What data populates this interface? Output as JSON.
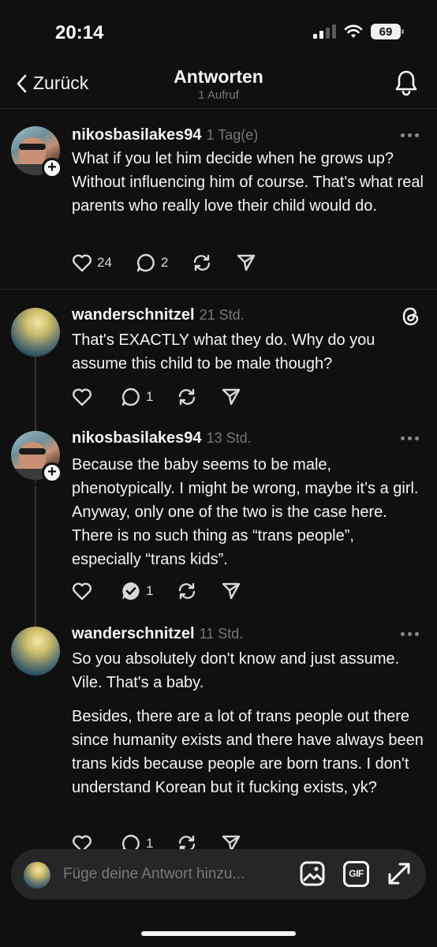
{
  "status_bar": {
    "time": "20:14",
    "battery": "69"
  },
  "nav": {
    "back_label": "Zurück",
    "title": "Antworten",
    "subtitle": "1 Aufruf"
  },
  "posts": [
    {
      "username": "nikosbasilakes94",
      "time": "1 Tag(e)",
      "paragraphs": [
        "What if you let him decide when he grows up? Without influencing him of course. That's what real parents who really love their child would do."
      ],
      "likes": "24",
      "replies": "2"
    },
    {
      "username": "wanderschnitzel",
      "time": "21 Std.",
      "paragraphs": [
        "That's EXACTLY what they do. Why do you assume this child to be male though?"
      ],
      "likes": "",
      "replies": "1"
    },
    {
      "username": "nikosbasilakes94",
      "time": "13 Std.",
      "paragraphs": [
        "Because the baby seems to be male, phenotypically. I might be wrong, maybe it’s a girl. Anyway, only one of the two is the case here. There is no such thing as “trans people”, especially “trans kids”."
      ],
      "likes": "",
      "replies": "1"
    },
    {
      "username": "wanderschnitzel",
      "time": "11 Std.",
      "paragraphs": [
        "So you absolutely don't know and just assume. Vile. That's a baby.",
        "Besides, there are a lot of trans people out there since humanity exists and there have always been trans kids because people are born trans. I don't understand Korean but it fucking exists, yk?"
      ],
      "likes": "",
      "replies": "1"
    }
  ],
  "compose": {
    "placeholder": "Füge deine Antwort hinzu...",
    "gif_label": "GIF"
  },
  "colors": {
    "background": "#101010",
    "text": "#f3f5f7",
    "muted": "#777777",
    "divider": "#262626",
    "compose_bg": "#262626"
  }
}
